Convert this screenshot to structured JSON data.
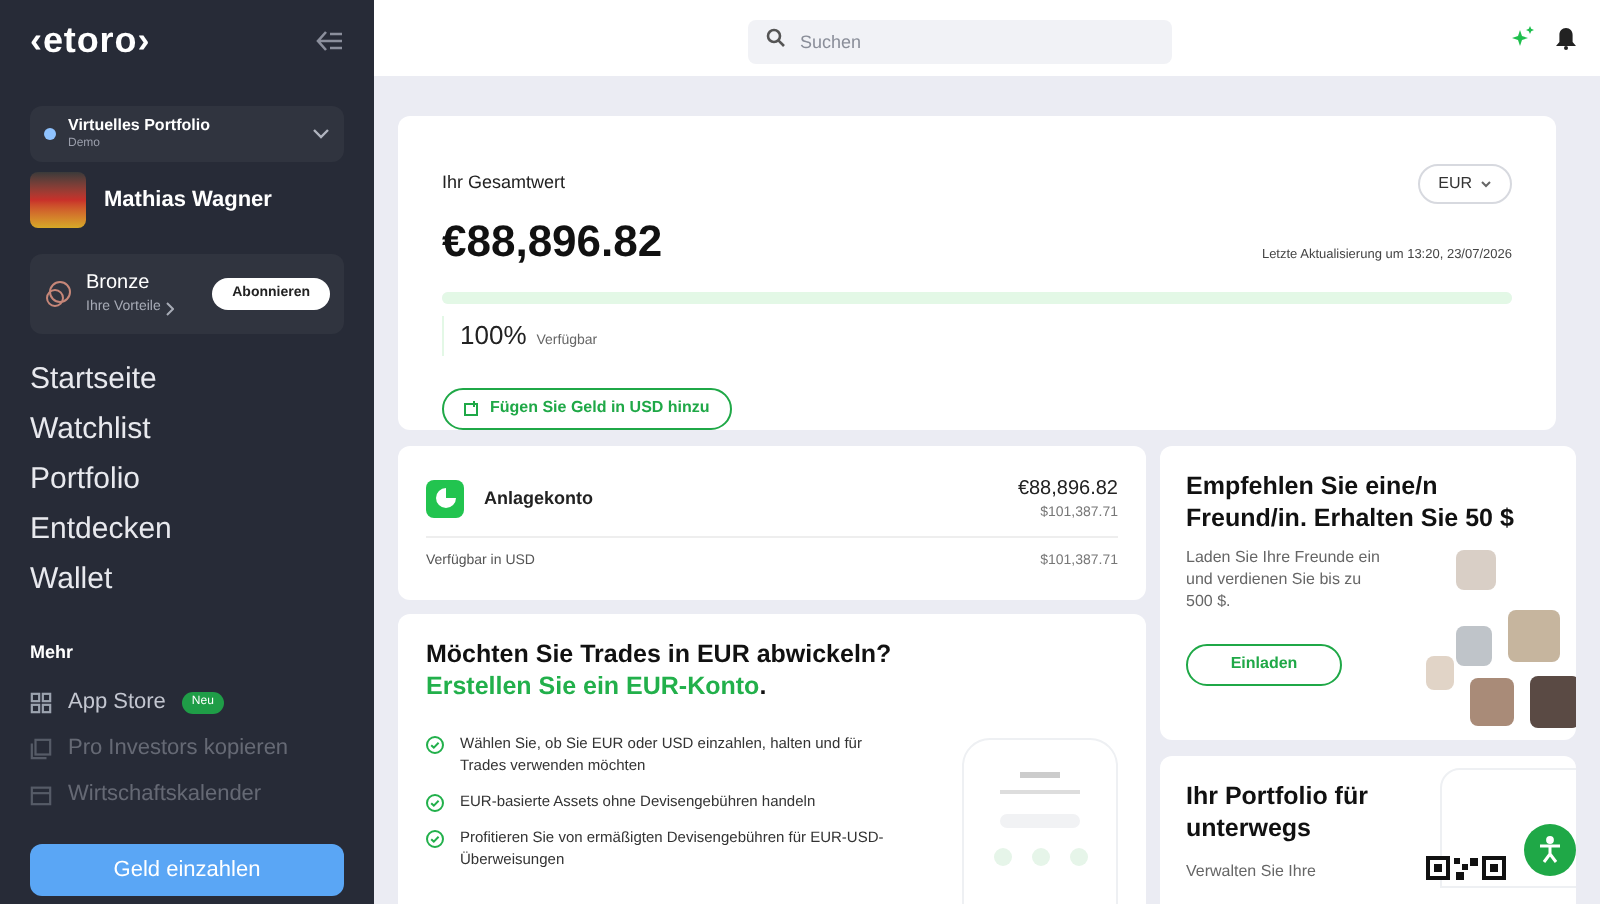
{
  "sidebar": {
    "logo": "‹etoro›",
    "portfolio": {
      "name": "Virtuelles Portfolio",
      "mode": "Demo"
    },
    "user": {
      "name": "Mathias Wagner"
    },
    "tier": {
      "name": "Bronze",
      "benefits": "Ihre Vorteile",
      "button": "Abonnieren"
    },
    "nav": [
      "Startseite",
      "Watchlist",
      "Portfolio",
      "Entdecken",
      "Wallet"
    ],
    "more_heading": "Mehr",
    "more_items": [
      {
        "label": "App Store",
        "badge": "Neu",
        "kind": "grid",
        "faded": false
      },
      {
        "label": "Pro Investors kopieren",
        "kind": "copy",
        "faded": true
      },
      {
        "label": "Wirtschaftskalender",
        "kind": "calendar",
        "faded": true
      }
    ],
    "deposit_button": "Geld einzahlen"
  },
  "top_bar": {
    "search": {
      "placeholder": "Suchen"
    }
  },
  "summary": {
    "title": "Ihr Gesamtwert",
    "currency": "EUR",
    "value": "€88,896.82",
    "updated": "Letzte Aktualisierung um 13:20, 23/07/2026",
    "level": 1,
    "percent": "100%",
    "percent_label": "Verfügbar",
    "add_funds": "Fügen Sie Geld in USD hinzu"
  },
  "account": {
    "name": "Anlagekonto",
    "value": "€88,896.82",
    "value_usd": "$101,387.71",
    "available_label": "Verfügbar in USD",
    "available_value": "$101,387.71"
  },
  "eur_promo": {
    "title": "Möchten Sie Trades in EUR abwickeln?",
    "link": "Erstellen Sie ein EUR-Konto",
    "link_suffix": ".",
    "bullets": [
      "Wählen Sie, ob Sie EUR oder USD einzahlen, halten und für Trades verwenden möchten",
      "EUR-basierte Assets ohne Devisengebühren handeln",
      "Profitieren Sie von ermäßigten Devisengebühren für EUR-USD-Überweisungen"
    ]
  },
  "referral": {
    "title": "Empfehlen Sie eine/n Freund/in. Erhalten Sie 50 $",
    "text": "Laden Sie Ihre Freunde ein und verdienen Sie bis zu 500 $.",
    "button": "Einladen"
  },
  "mobile": {
    "title": "Ihr Portfolio für unterwegs",
    "text": "Verwalten Sie Ihre"
  }
}
